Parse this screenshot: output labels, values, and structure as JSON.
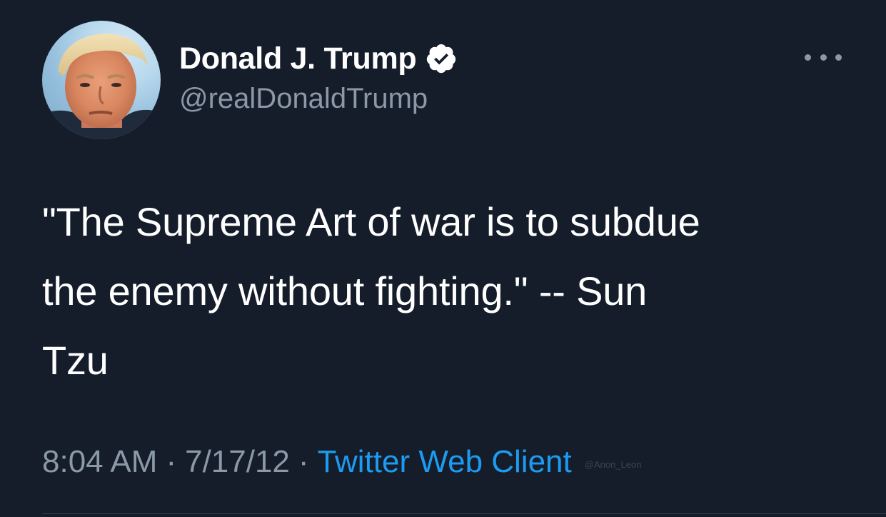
{
  "tweet": {
    "author": {
      "display_name": "Donald J. Trump",
      "handle": "@realDonaldTrump",
      "verified": true
    },
    "text": "\"The Supreme Art of war is to subdue\nthe enemy without fighting.\" -- Sun\nTzu",
    "meta": {
      "time": "8:04 AM",
      "separator": "·",
      "date": "7/17/12",
      "source": "Twitter Web Client"
    },
    "watermark": "@Anon_Leon"
  },
  "icons": {
    "verified": "verified-badge-icon",
    "more": "more-options-icon"
  },
  "colors": {
    "background": "#151d2b",
    "text_primary": "#ffffff",
    "text_secondary": "#8b98a5",
    "link": "#1d9bf0"
  }
}
